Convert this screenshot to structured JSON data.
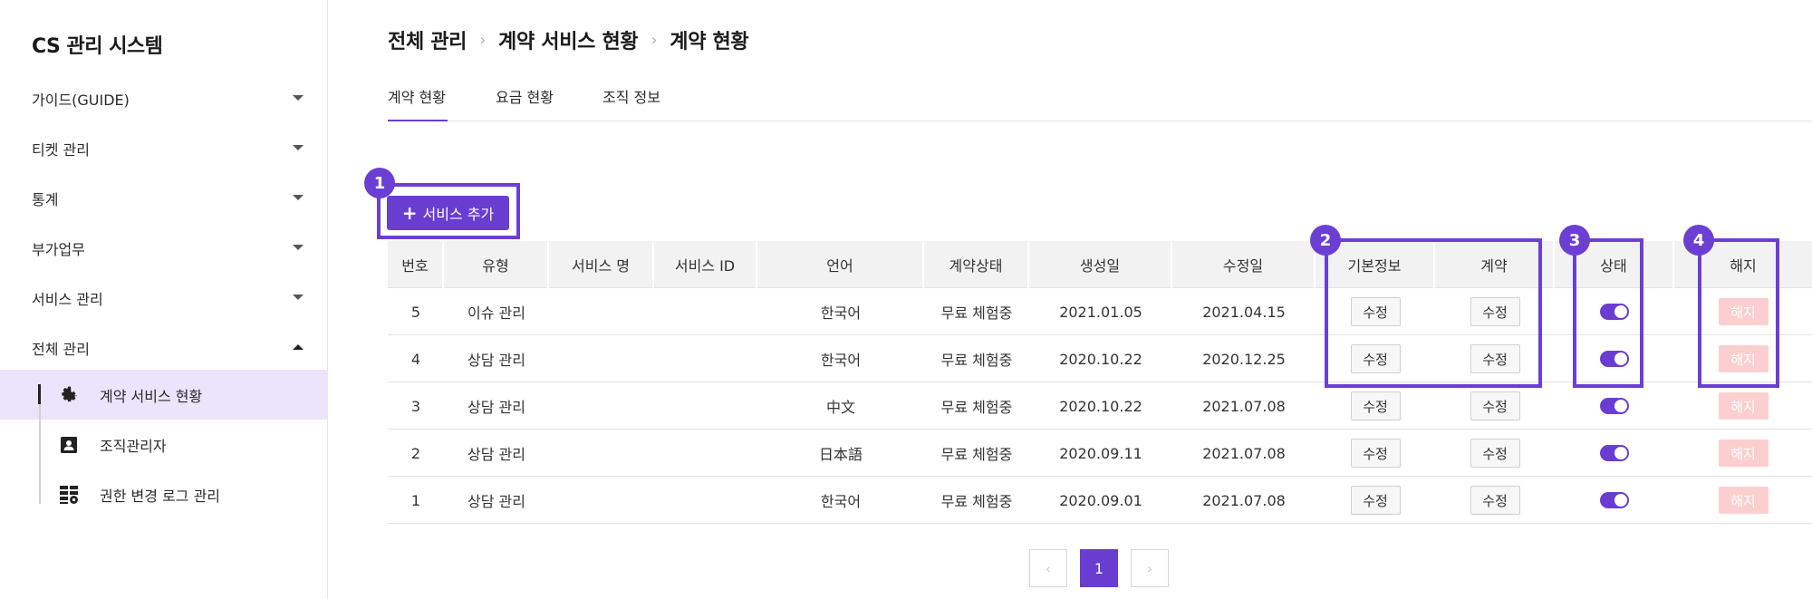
{
  "app_title": "CS 관리 시스템",
  "sidebar": {
    "menu": [
      {
        "label": "가이드(GUIDE)",
        "expanded": false
      },
      {
        "label": "티켓 관리",
        "expanded": false
      },
      {
        "label": "통계",
        "expanded": false
      },
      {
        "label": "부가업무",
        "expanded": false
      },
      {
        "label": "서비스 관리",
        "expanded": false
      },
      {
        "label": "전체 관리",
        "expanded": true
      }
    ],
    "submenu": [
      {
        "label": "계약 서비스 현황",
        "icon": "gear-icon",
        "active": true
      },
      {
        "label": "조직관리자",
        "icon": "id-card-icon",
        "active": false
      },
      {
        "label": "권한 변경 로그 관리",
        "icon": "log-settings-icon",
        "active": false
      }
    ]
  },
  "breadcrumb": [
    "전체 관리",
    "계약 서비스 현황",
    "계약 현황"
  ],
  "tabs": [
    {
      "label": "계약 현황",
      "active": true
    },
    {
      "label": "요금 현황",
      "active": false
    },
    {
      "label": "조직 정보",
      "active": false
    }
  ],
  "add_button_label": "서비스 추가",
  "table": {
    "headers": [
      "번호",
      "유형",
      "서비스 명",
      "서비스 ID",
      "언어",
      "계약상태",
      "생성일",
      "수정일",
      "기본정보",
      "계약",
      "상태",
      "해지"
    ],
    "edit_label": "수정",
    "cancel_label": "해지",
    "rows": [
      {
        "no": "5",
        "type": "이슈 관리",
        "service_name": "",
        "service_id": "",
        "language": "한국어",
        "status": "무료 체험중",
        "created": "2021.01.05",
        "modified": "2021.04.15",
        "enabled": true
      },
      {
        "no": "4",
        "type": "상담 관리",
        "service_name": "",
        "service_id": "",
        "language": "한국어",
        "status": "무료 체험중",
        "created": "2020.10.22",
        "modified": "2020.12.25",
        "enabled": true
      },
      {
        "no": "3",
        "type": "상담 관리",
        "service_name": "",
        "service_id": "",
        "language": "中文",
        "status": "무료 체험중",
        "created": "2020.10.22",
        "modified": "2021.07.08",
        "enabled": true
      },
      {
        "no": "2",
        "type": "상담 관리",
        "service_name": "",
        "service_id": "",
        "language": "日本語",
        "status": "무료 체험중",
        "created": "2020.09.11",
        "modified": "2021.07.08",
        "enabled": true
      },
      {
        "no": "1",
        "type": "상담 관리",
        "service_name": "",
        "service_id": "",
        "language": "한국어",
        "status": "무료 체험중",
        "created": "2020.09.01",
        "modified": "2021.07.08",
        "enabled": true
      }
    ]
  },
  "annotations": [
    "1",
    "2",
    "3",
    "4"
  ],
  "pagination": {
    "prev": "‹",
    "current": "1",
    "next": "›"
  },
  "colors": {
    "accent": "#6a3dd1",
    "annotation": "#6b3fd4",
    "active_menu_bg": "#ebe4fb",
    "cancel_disabled": "#fbcfcf"
  }
}
